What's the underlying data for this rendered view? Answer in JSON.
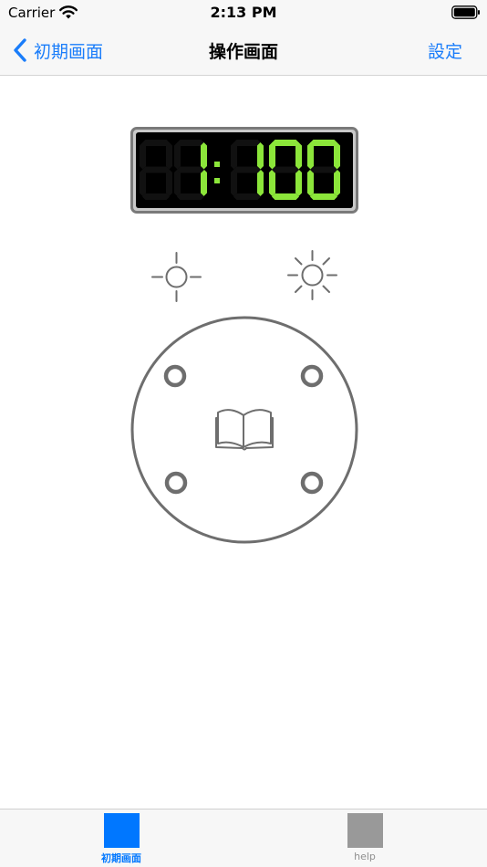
{
  "status_bar": {
    "carrier": "Carrier",
    "time": "2:13 PM",
    "icons": [
      "wifi-icon",
      "battery-icon"
    ]
  },
  "nav_bar": {
    "back_label": "初期画面",
    "title": "操作画面",
    "right_button": "設定"
  },
  "display": {
    "value": "1:100",
    "digit_color": "#8ce63a",
    "background": "#000000"
  },
  "controls": {
    "brightness_down_icon": "sun-outline-icon",
    "brightness_up_icon": "sun-rays-icon",
    "dial_center_icon": "book-icon"
  },
  "tab_bar": {
    "tabs": [
      {
        "label": "初期画面",
        "active": true
      },
      {
        "label": "help",
        "active": false
      }
    ]
  },
  "colors": {
    "accent": "#1a7dfa",
    "tab_active": "#0077ff",
    "tab_inactive": "#999999",
    "control_stroke": "#6e6e6e"
  }
}
